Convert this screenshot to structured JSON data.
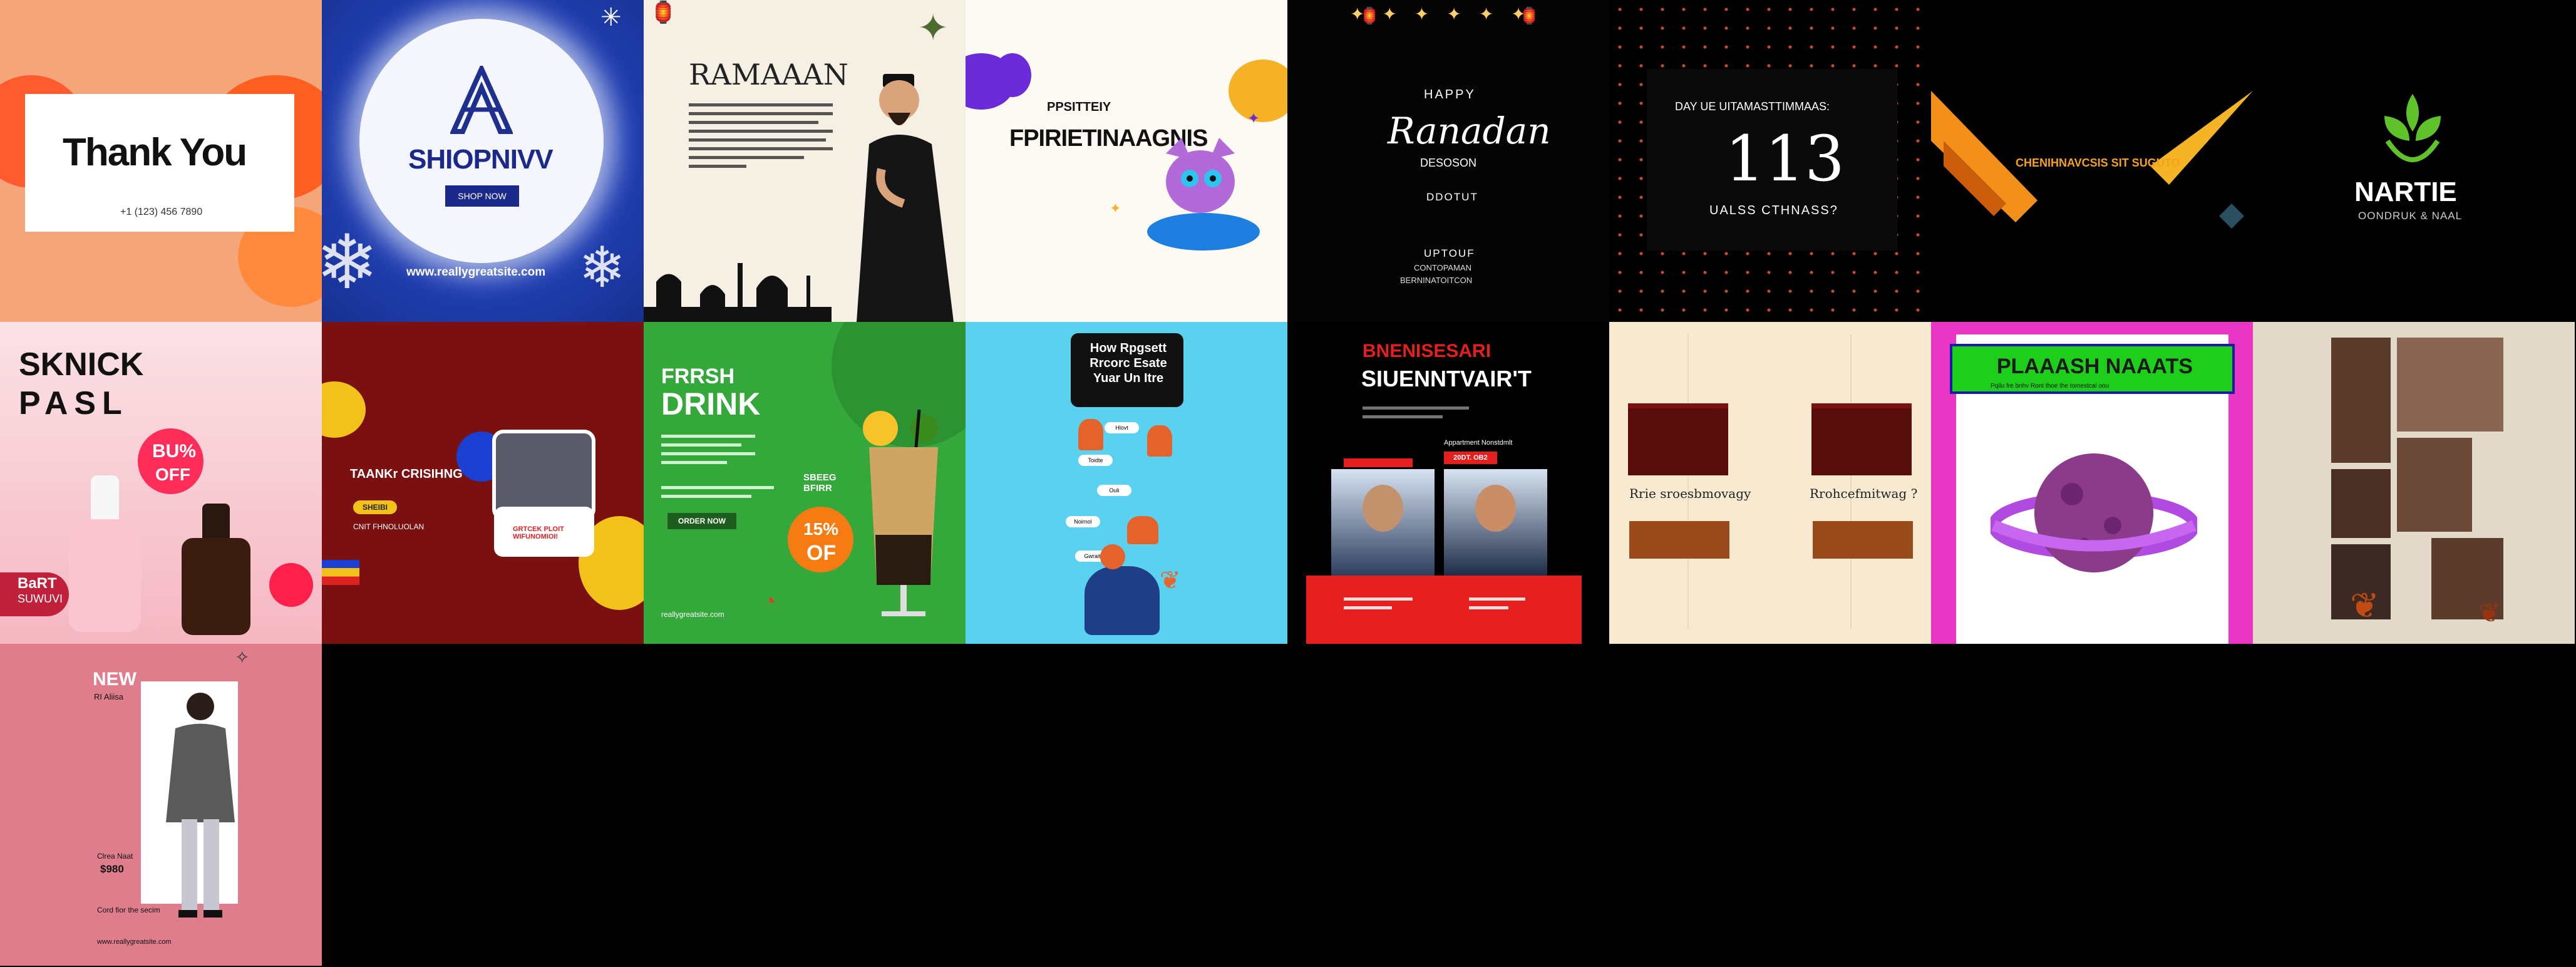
{
  "gallery": {
    "background": "#000000",
    "tiles": [
      {
        "id": "thank-you",
        "bg": "#f4a57a",
        "title": "Thank You",
        "phone": "+1 (123) 456 7890"
      },
      {
        "id": "shop-now",
        "bg": "#2140b5",
        "brand": "SHIOPNIVV",
        "button": "SHOP NOW",
        "url": "www.reallygreatsite.com"
      },
      {
        "id": "ramadan-1",
        "bg": "#f5f0e3",
        "title": "RAMAAAN"
      },
      {
        "id": "positive-fp",
        "bg": "#fdf9f3",
        "kicker": "PPSITTEIY",
        "title": "FPIRIETINAAGNIS"
      },
      {
        "id": "ramadan-2",
        "bg": "#050505",
        "kicker": "HAPPY",
        "title": "Ranadan",
        "sub1": "DESOSON",
        "sub2": "DDOTUT",
        "sub3": "UPTOUF",
        "sub4": "CONTOPAMAN",
        "sub5": "BERNINATOITCON"
      },
      {
        "id": "countdown",
        "bg": "#000000",
        "kicker": "DAY UE UITAMASTTIMMAAS:",
        "number": "113",
        "sub": "UALSS CTHNASS?"
      },
      {
        "id": "geo-logo",
        "bg": "#000000",
        "brand_text": "CHENIHNAVCSIS SIT SUGUTO"
      },
      {
        "id": "nartie",
        "bg": "#000000",
        "brand": "NARTIE",
        "tagline": "OONDRUK & NAAL"
      },
      {
        "id": "skincare",
        "bg": "#f7c6ce",
        "title1": "SKNICK",
        "title2": "PASL",
        "badge": "BU%",
        "badge2": "OFF",
        "footer1": "BaRT",
        "footer2": "SUWUVI"
      },
      {
        "id": "thank-bright",
        "bg": "#7a1010",
        "title": "TAANKr CRISIHNG",
        "pill": "SHEIBI",
        "card": "GRTCEK PLOIT WIFUNOMIOI!",
        "caption": "CNIT FHNOLUOLAN"
      },
      {
        "id": "fresh-drink",
        "bg": "#34a83b",
        "title1": "FRRSH",
        "title2": "DRINK",
        "tag": "SBEEG BFIRR",
        "badge1": "15%",
        "badge2": "OF",
        "button": "ORDER NOW",
        "url": "reallygreatsite.com"
      },
      {
        "id": "how-to",
        "bg": "#5ad1ef",
        "title": "How Rpgsett Rrcorc Esate Yuar Un Itre",
        "chips": [
          "Hlovt",
          "Toidte",
          "Ouli",
          "Noirnol",
          "Gwrait"
        ]
      },
      {
        "id": "seminar",
        "bg": "#000000",
        "title1": "BNENISESARI",
        "title2": "SIUENNTVAIR'T",
        "info": "Appartment Nonstdmlt",
        "date": "20DT. OB2"
      },
      {
        "id": "cream-tiles",
        "bg": "#f8ead0",
        "label1": "Rrie sroesbmovagy",
        "label2": "Rrohcefmitwag ?"
      },
      {
        "id": "planet",
        "bg": "#e936c4",
        "title": "PLAAASH NAAATS",
        "sub": "Pqilu fre bnhv Ront thoe the tomestcal oou"
      },
      {
        "id": "autumn",
        "bg": "#e3d9c9"
      },
      {
        "id": "fashion",
        "bg": "#e07d8d",
        "title": "NEW",
        "sub": "RI Aliisa",
        "price_label": "Clrea Naat",
        "price": "$980",
        "footer": "Cord fior the secim",
        "url": "www.reallygreatsite.com"
      }
    ]
  }
}
